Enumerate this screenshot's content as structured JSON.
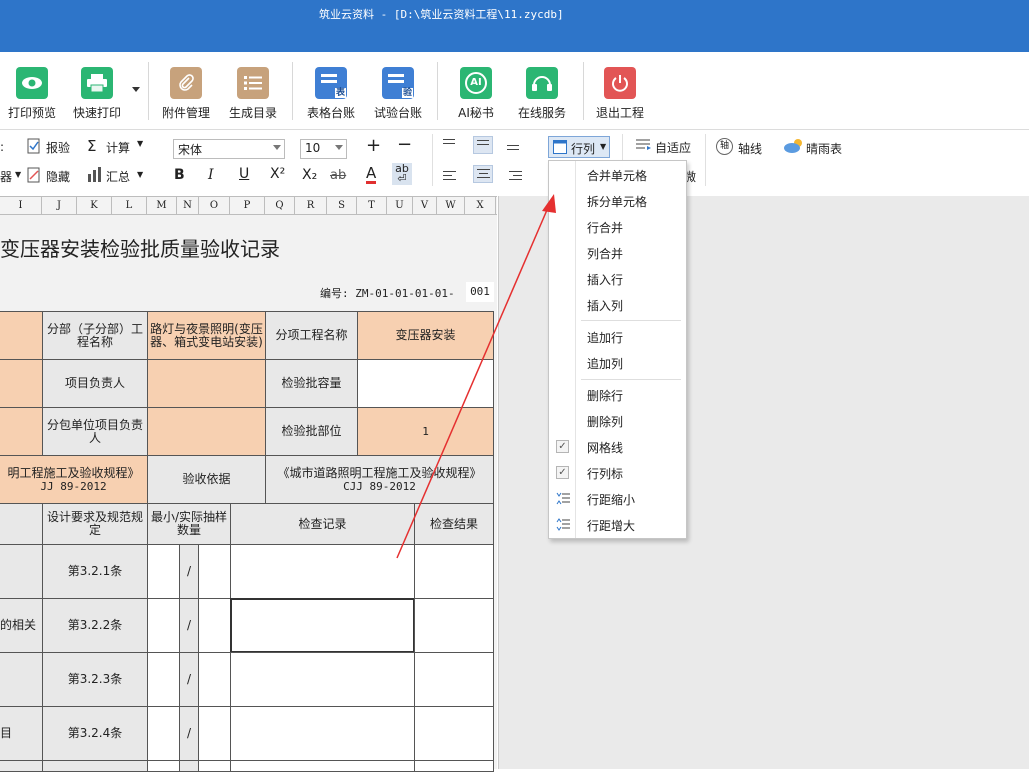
{
  "window": {
    "title": "筑业云资料 - [D:\\筑业云资料工程\\11.zycdb]"
  },
  "ribbon": {
    "items": [
      {
        "label": "打印预览",
        "icon": "eye-icon",
        "color": "#2bb673"
      },
      {
        "label": "快速打印",
        "icon": "printer-icon",
        "color": "#2bb673"
      },
      {
        "label": "附件管理",
        "icon": "attachment-icon",
        "color": "#c7a27c"
      },
      {
        "label": "生成目录",
        "icon": "list-icon",
        "color": "#c7a27c"
      },
      {
        "label": "表格台账",
        "icon": "table-ledger-icon",
        "color": "#3f7fd4",
        "badge": "表"
      },
      {
        "label": "试验台账",
        "icon": "test-ledger-icon",
        "color": "#3f7fd4",
        "badge": "验"
      },
      {
        "label": "AI秘书",
        "icon": "ai-icon",
        "color": "#2bb673",
        "badge": "AI"
      },
      {
        "label": "在线服务",
        "icon": "headset-icon",
        "color": "#2bb673"
      },
      {
        "label": "退出工程",
        "icon": "power-icon",
        "color": "#e25555"
      }
    ]
  },
  "format_bar": {
    "row1": {
      "partial_left": "",
      "check": "报验",
      "calc": "计算",
      "font_name": "宋体",
      "font_size": "10",
      "rowcol": "行列",
      "autofit": "自适应",
      "axis": "轴线",
      "weather": "晴雨表"
    },
    "row2": {
      "partial_left": "器",
      "hide": "隐藏",
      "summary": "汇总",
      "bold": "B",
      "italic": "I",
      "underline": "U",
      "superscript": "X²",
      "subscript": "X₂",
      "strike": "ab",
      "fontcolor": "A",
      "wrap": "ab",
      "partial_right": "微"
    },
    "accent": "#2e75c9"
  },
  "columns": [
    "I",
    "J",
    "K",
    "L",
    "M",
    "N",
    "O",
    "P",
    "Q",
    "R",
    "S",
    "T",
    "U",
    "V",
    "W",
    "X"
  ],
  "sheet": {
    "title": "变压器安装检验批质量验收记录",
    "serial_label": "编号: ZM-01-01-01-01-",
    "serial_value": "001",
    "labels": {
      "sub_project": "分部（子分部）工程名称",
      "sub_project_value": "路灯与夜景照明(变压器、箱式变电站安装)",
      "item_project": "分项工程名称",
      "item_project_value": "变压器安装",
      "pm": "项目负责人",
      "capacity": "检验批容量",
      "sub_pm": "分包单位项目负责人",
      "location": "检验批部位",
      "location_value": "1",
      "std_left": "明工程施工及验收规程》",
      "std_left_code": "JJ 89-2012",
      "basis": "验收依据",
      "std_right": "《城市道路照明工程施工及验收规程》",
      "std_right_code": "CJJ 89-2012",
      "design_req": "设计要求及规范规定",
      "sample": "最小/实际抽样数量",
      "record": "检查记录",
      "result": "检查结果"
    },
    "rows": [
      {
        "left": "",
        "clause": "第3.2.1条",
        "slash": "/"
      },
      {
        "left": "的相关",
        "clause": "第3.2.2条",
        "slash": "/"
      },
      {
        "left": "",
        "clause": "第3.2.3条",
        "slash": "/"
      },
      {
        "left": "目",
        "clause": "第3.2.4条",
        "slash": "/"
      }
    ]
  },
  "menu": {
    "items": [
      {
        "label": "合并单元格"
      },
      {
        "label": "拆分单元格"
      },
      {
        "label": "行合并"
      },
      {
        "label": "列合并"
      },
      {
        "label": "插入行"
      },
      {
        "label": "插入列"
      },
      {
        "label": "追加行"
      },
      {
        "label": "追加列"
      },
      {
        "label": "删除行"
      },
      {
        "label": "删除列"
      },
      {
        "label": "网格线",
        "checked": true
      },
      {
        "label": "行列标",
        "checked": true
      },
      {
        "label": "行距缩小",
        "icon": "line-spacing-decrease-icon"
      },
      {
        "label": "行距增大",
        "icon": "line-spacing-increase-icon"
      }
    ]
  },
  "annotation": {
    "color": "#e53030"
  }
}
